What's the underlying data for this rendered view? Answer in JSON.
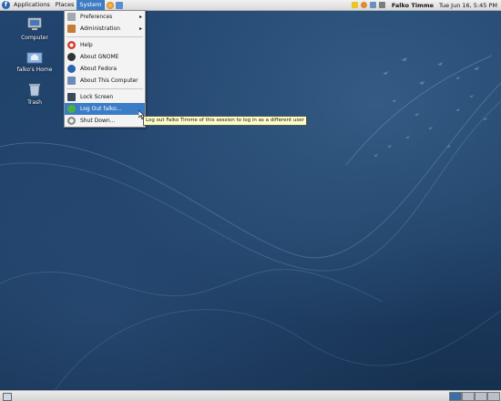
{
  "top_panel": {
    "menus": [
      "Applications",
      "Places",
      "System"
    ],
    "user_name": "Falko Timme",
    "clock": "Tue Jun 16,   5:45 PM"
  },
  "desktop_icons": [
    {
      "label": "Computer"
    },
    {
      "label": "falko's Home"
    },
    {
      "label": "Trash"
    }
  ],
  "system_menu": {
    "preferences": "Preferences",
    "administration": "Administration",
    "help": "Help",
    "about_gnome": "About GNOME",
    "about_fedora": "About Fedora",
    "about_computer": "About This Computer",
    "lock_screen": "Lock Screen",
    "log_out": "Log Out falko...",
    "shut_down": "Shut Down..."
  },
  "tooltip": "Log out Falko Timme of this session to log in as a different user",
  "colors": {
    "selection": "#3a7cc7",
    "desktop": "#1e3f66",
    "tooltip_bg": "#fdfdc8"
  },
  "icons": {
    "fedora": "fedora-logo-icon",
    "help": "help-lifebuoy-icon",
    "lock": "lock-screen-icon",
    "logout": "running-man-icon",
    "shutdown": "power-icon"
  }
}
